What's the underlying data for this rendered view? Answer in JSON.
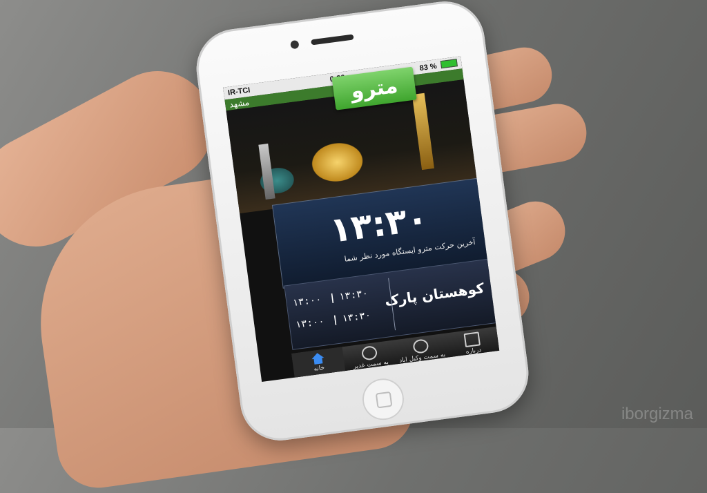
{
  "status_bar": {
    "carrier": "IR-TCI",
    "time": "0:36",
    "battery": "83 %"
  },
  "app": {
    "city": "مشهد",
    "logo_text": "مترو"
  },
  "departure": {
    "time": "۱۳:۳۰",
    "caption": "آخرین حرکت مترو ایستگاه مورد نظر شما"
  },
  "station": {
    "name": "کوهستان پارک"
  },
  "timetable": {
    "rows": [
      {
        "left": "۱۳:۰۰",
        "right": "۱۳:۳۰"
      },
      {
        "left": "۱۳:۰۰",
        "right": "۱۳:۳۰"
      }
    ],
    "separator": "|"
  },
  "tabs": [
    {
      "label": "خانه",
      "icon": "home-icon"
    },
    {
      "label": "به سمت غدیر",
      "icon": "clock-icon"
    },
    {
      "label": "به سمت وکیل اباد",
      "icon": "clock-icon"
    },
    {
      "label": "درباره",
      "icon": "film-icon"
    }
  ],
  "watermark": "iborgizma"
}
